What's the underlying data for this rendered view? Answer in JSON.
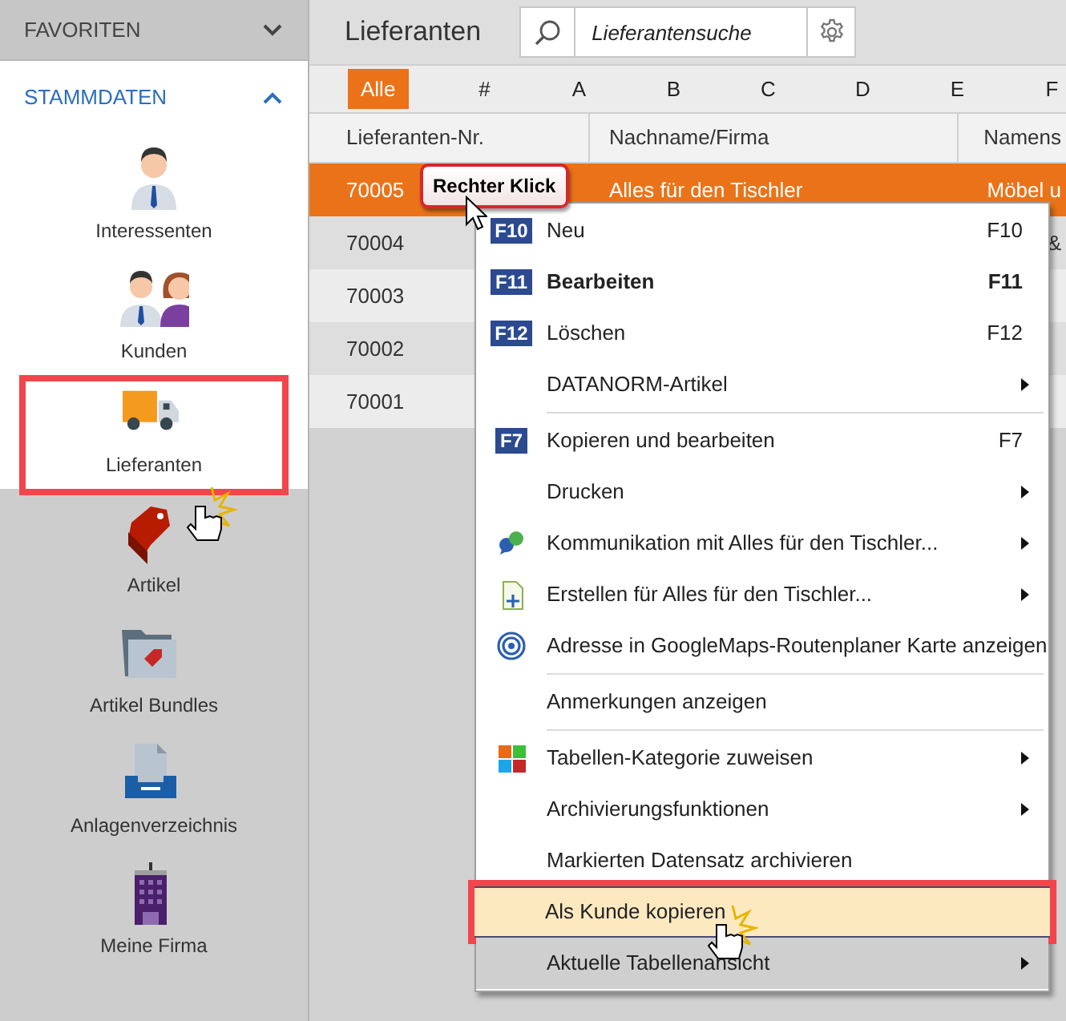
{
  "sidebar": {
    "sections": [
      {
        "title": "FAVORITEN",
        "expanded": false
      },
      {
        "title": "STAMMDATEN",
        "expanded": true
      }
    ],
    "items": [
      {
        "label": "Interessenten",
        "selected": false
      },
      {
        "label": "Kunden",
        "selected": false
      },
      {
        "label": "Lieferanten",
        "selected": true
      },
      {
        "label": "Artikel",
        "selected": false
      },
      {
        "label": "Artikel Bundles",
        "selected": false
      },
      {
        "label": "Anlagenverzeichnis",
        "selected": false
      },
      {
        "label": "Meine Firma",
        "selected": false
      }
    ]
  },
  "main": {
    "title": "Lieferanten",
    "search": {
      "placeholder": "Lieferantensuche"
    },
    "letters": [
      {
        "label": "Alle",
        "selected": true
      },
      {
        "label": "#",
        "selected": false
      },
      {
        "label": "A",
        "selected": false
      },
      {
        "label": "B",
        "selected": false
      },
      {
        "label": "C",
        "selected": false
      },
      {
        "label": "D",
        "selected": false
      },
      {
        "label": "E",
        "selected": false
      },
      {
        "label": "F",
        "selected": false
      }
    ],
    "table": {
      "columns": [
        "Lieferanten-Nr.",
        "Nachname/Firma",
        "Namens"
      ],
      "rows": [
        {
          "cells": [
            "70005",
            "Alles für den Tischler",
            "Möbel u"
          ],
          "selected": true
        },
        {
          "cells": [
            "70004",
            "",
            "&"
          ],
          "selected": false
        },
        {
          "cells": [
            "70003"
          ],
          "selected": false
        },
        {
          "cells": [
            "70002"
          ],
          "selected": false
        },
        {
          "cells": [
            "70001"
          ],
          "selected": false
        }
      ]
    }
  },
  "callout": {
    "text": "Rechter Klick"
  },
  "context_menu": {
    "items": [
      {
        "kind": "item",
        "key": "F10",
        "label": "Neu",
        "shortcut": "F10",
        "default": false,
        "submenu": false,
        "highlighted": false
      },
      {
        "kind": "item",
        "key": "F11",
        "label": "Bearbeiten",
        "shortcut": "F11",
        "default": true,
        "submenu": false,
        "highlighted": false
      },
      {
        "kind": "item",
        "key": "F12",
        "label": "Löschen",
        "shortcut": "F12",
        "default": false,
        "submenu": false,
        "highlighted": false
      },
      {
        "kind": "item",
        "label": "DATANORM-Artikel",
        "default": false,
        "submenu": true,
        "highlighted": false
      },
      {
        "kind": "separator"
      },
      {
        "kind": "item",
        "key": "F7",
        "label": "Kopieren und bearbeiten",
        "shortcut": "F7",
        "default": false,
        "submenu": false,
        "highlighted": false
      },
      {
        "kind": "item",
        "label": "Drucken",
        "default": false,
        "submenu": true,
        "highlighted": false
      },
      {
        "kind": "item",
        "label": "Kommunikation mit Alles für den Tischler...",
        "default": false,
        "submenu": true,
        "highlighted": false
      },
      {
        "kind": "item",
        "label": "Erstellen für Alles für den Tischler...",
        "default": false,
        "submenu": true,
        "highlighted": false
      },
      {
        "kind": "item",
        "label": "Adresse in GoogleMaps-Routenplaner Karte anzeigen",
        "default": false,
        "submenu": false,
        "highlighted": false
      },
      {
        "kind": "separator"
      },
      {
        "kind": "item",
        "label": "Anmerkungen anzeigen",
        "default": false,
        "submenu": false,
        "highlighted": false
      },
      {
        "kind": "separator"
      },
      {
        "kind": "item",
        "label": "Tabellen-Kategorie zuweisen",
        "default": false,
        "submenu": true,
        "highlighted": false
      },
      {
        "kind": "item",
        "label": "Archivierungsfunktionen",
        "default": false,
        "submenu": true,
        "highlighted": false
      },
      {
        "kind": "item",
        "label": "Markierten Datensatz archivieren",
        "default": false,
        "submenu": false,
        "highlighted": false
      },
      {
        "kind": "item",
        "label": "Als Kunde kopieren",
        "default": false,
        "submenu": false,
        "highlighted": true
      },
      {
        "kind": "item",
        "label": "Aktuelle Tabellenansicht",
        "default": false,
        "submenu": true,
        "highlighted": false
      }
    ]
  }
}
